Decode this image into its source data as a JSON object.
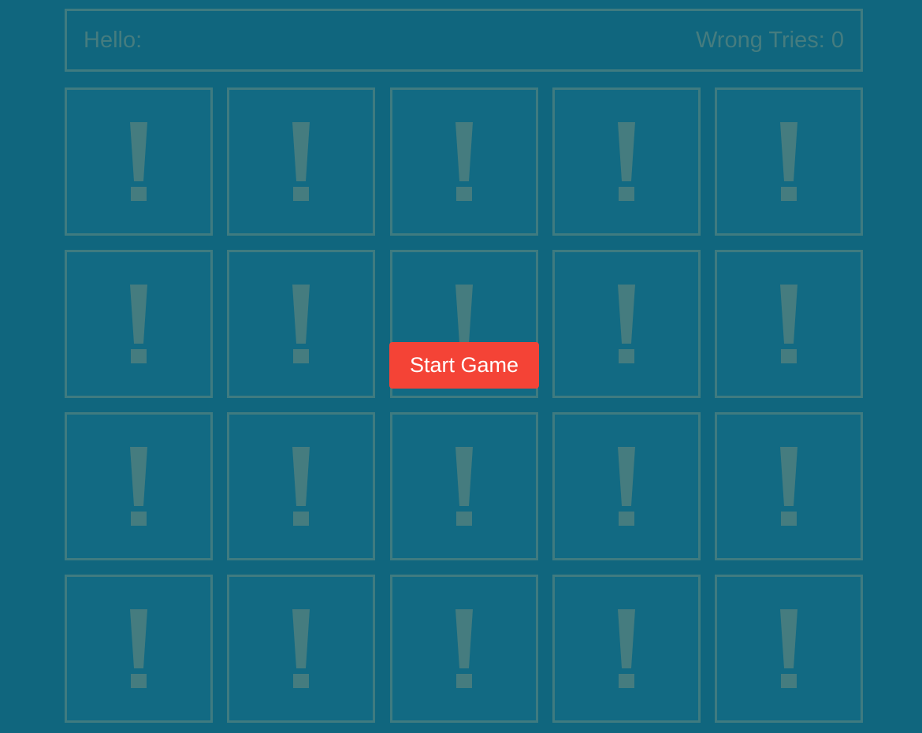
{
  "header": {
    "greeting": "Hello:",
    "wrong_tries_label": "Wrong Tries: 0"
  },
  "tiles": {
    "rows": 4,
    "columns": 5,
    "face_down_symbol": "exclamation-mark",
    "count": 20
  },
  "start_button": {
    "label": "Start Game"
  },
  "colors": {
    "background": "#10667e",
    "tile_fill": "#126a83",
    "tile_border": "#3f7b80",
    "symbol": "#457c7f",
    "start_button": "#f44336"
  }
}
